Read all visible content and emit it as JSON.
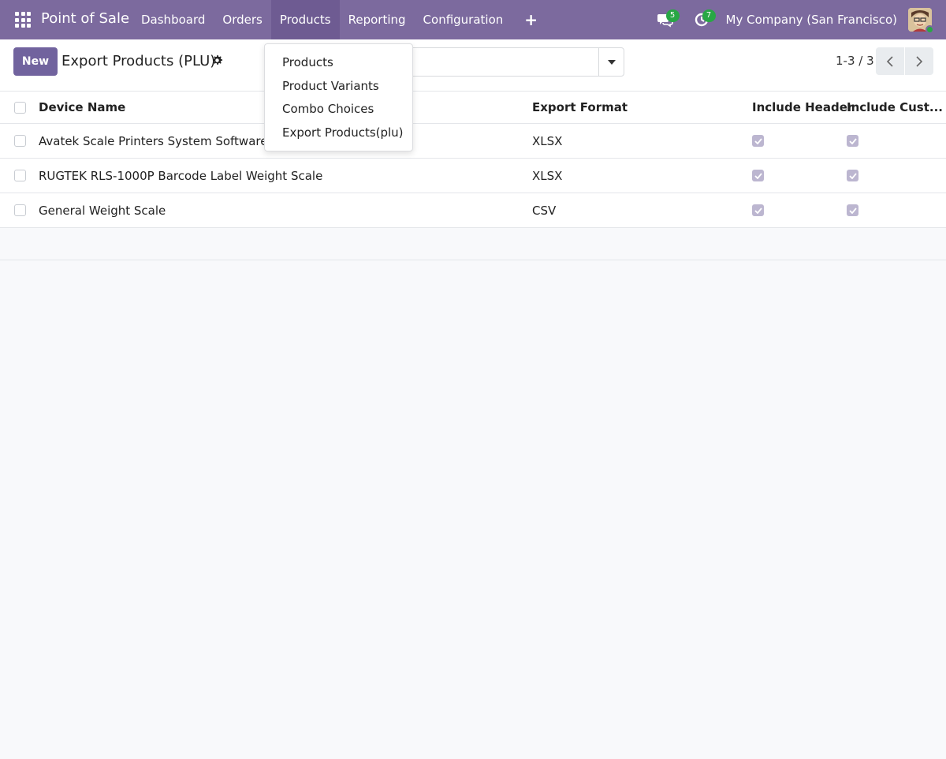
{
  "navbar": {
    "brand": "Point of Sale",
    "menu": [
      "Dashboard",
      "Orders",
      "Products",
      "Reporting",
      "Configuration"
    ],
    "active_menu": "Products",
    "messages_badge": "5",
    "activities_badge": "7",
    "company": "My Company (San Francisco)"
  },
  "control_panel": {
    "new_label": "New",
    "title": "Export Products (PLU)",
    "search_placeholder": "",
    "pager": "1-3 / 3"
  },
  "dropdown": {
    "items": [
      "Products",
      "Product Variants",
      "Combo Choices",
      "Export Products(plu)"
    ]
  },
  "table": {
    "columns": [
      "Device Name",
      "Export Format",
      "Include Header",
      "Include Cust..."
    ],
    "rows": [
      {
        "name": "Avatek Scale Printers System Software",
        "format": "XLSX",
        "include_header": true,
        "include_cust": true
      },
      {
        "name": "RUGTEK RLS-1000P Barcode Label Weight Scale",
        "format": "XLSX",
        "include_header": true,
        "include_cust": true
      },
      {
        "name": "General Weight Scale",
        "format": "CSV",
        "include_header": true,
        "include_cust": true
      }
    ]
  },
  "colors": {
    "navbar": "#7c6a9e",
    "primary_button": "#71639e",
    "badge": "#28a745"
  }
}
